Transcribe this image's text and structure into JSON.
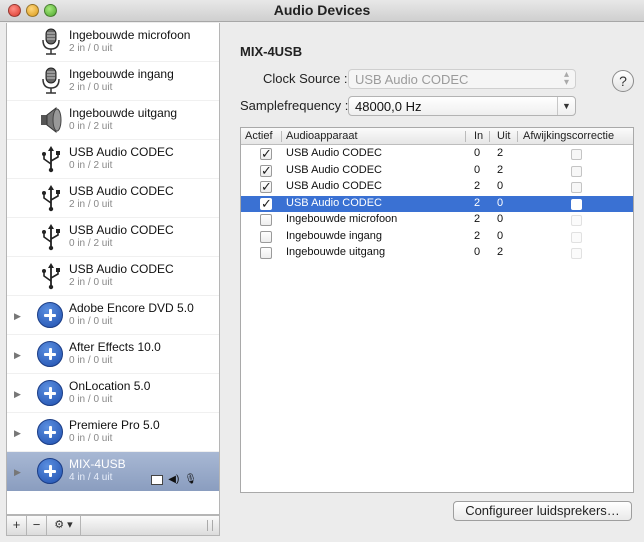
{
  "window": {
    "title": "Audio Devices"
  },
  "devices": [
    {
      "name": "Ingebouwde microfoon",
      "channels": "2 in / 0 uit",
      "icon": "microphone-icon"
    },
    {
      "name": "Ingebouwde ingang",
      "channels": "2 in / 0 uit",
      "icon": "microphone-icon"
    },
    {
      "name": "Ingebouwde uitgang",
      "channels": "0 in / 2 uit",
      "icon": "speaker-icon"
    },
    {
      "name": "USB Audio CODEC",
      "channels": "0 in / 2 uit",
      "icon": "usb-icon"
    },
    {
      "name": "USB Audio CODEC",
      "channels": "2 in / 0 uit",
      "icon": "usb-icon"
    },
    {
      "name": "USB Audio CODEC",
      "channels": "0 in / 2 uit",
      "icon": "usb-icon"
    },
    {
      "name": "USB Audio CODEC",
      "channels": "2 in / 0 uit",
      "icon": "usb-icon"
    },
    {
      "name": "Adobe Encore DVD 5.0",
      "channels": "0 in / 0 uit",
      "icon": "aggregate-plus-icon"
    },
    {
      "name": "After Effects 10.0",
      "channels": "0 in / 0 uit",
      "icon": "aggregate-plus-icon"
    },
    {
      "name": "OnLocation 5.0",
      "channels": "0 in / 0 uit",
      "icon": "aggregate-plus-icon"
    },
    {
      "name": "Premiere Pro 5.0",
      "channels": "0 in / 0 uit",
      "icon": "aggregate-plus-icon"
    },
    {
      "name": "MIX-4USB",
      "channels": "4 in / 4 uit",
      "icon": "aggregate-plus-icon",
      "selected": true
    }
  ],
  "detail": {
    "device_title": "MIX-4USB",
    "clock_source_label": "Clock Source :",
    "clock_source_value": "USB Audio CODEC",
    "samplerate_label": "Samplefrequency :",
    "samplerate_value": "48000,0 Hz",
    "help_label": "?",
    "configure_label": "Configureer luidsprekers…"
  },
  "table": {
    "headers": {
      "active": "Actief",
      "device": "Audioapparaat",
      "in": "In",
      "out": "Uit",
      "drift": "Afwijkingscorrectie"
    },
    "rows": [
      {
        "active": true,
        "device": "USB Audio CODEC",
        "in": "0",
        "out": "2",
        "drift": false,
        "selected": false
      },
      {
        "active": true,
        "device": "USB Audio CODEC",
        "in": "0",
        "out": "2",
        "drift": false,
        "selected": false
      },
      {
        "active": true,
        "device": "USB Audio CODEC",
        "in": "2",
        "out": "0",
        "drift": false,
        "selected": false
      },
      {
        "active": true,
        "device": "USB Audio CODEC",
        "in": "2",
        "out": "0",
        "drift": false,
        "selected": true
      },
      {
        "active": false,
        "device": "Ingebouwde microfoon",
        "in": "2",
        "out": "0",
        "drift": false,
        "selected": false
      },
      {
        "active": false,
        "device": "Ingebouwde ingang",
        "in": "2",
        "out": "0",
        "drift": false,
        "selected": false
      },
      {
        "active": false,
        "device": "Ingebouwde uitgang",
        "in": "0",
        "out": "2",
        "drift": false,
        "selected": false
      }
    ]
  },
  "footer": {
    "add_label": "+",
    "remove_label": "−",
    "gear_label": "⚙ ▾"
  },
  "colors": {
    "selection": "#3a71d3",
    "sidebar_selection": "#8a9dbf"
  }
}
